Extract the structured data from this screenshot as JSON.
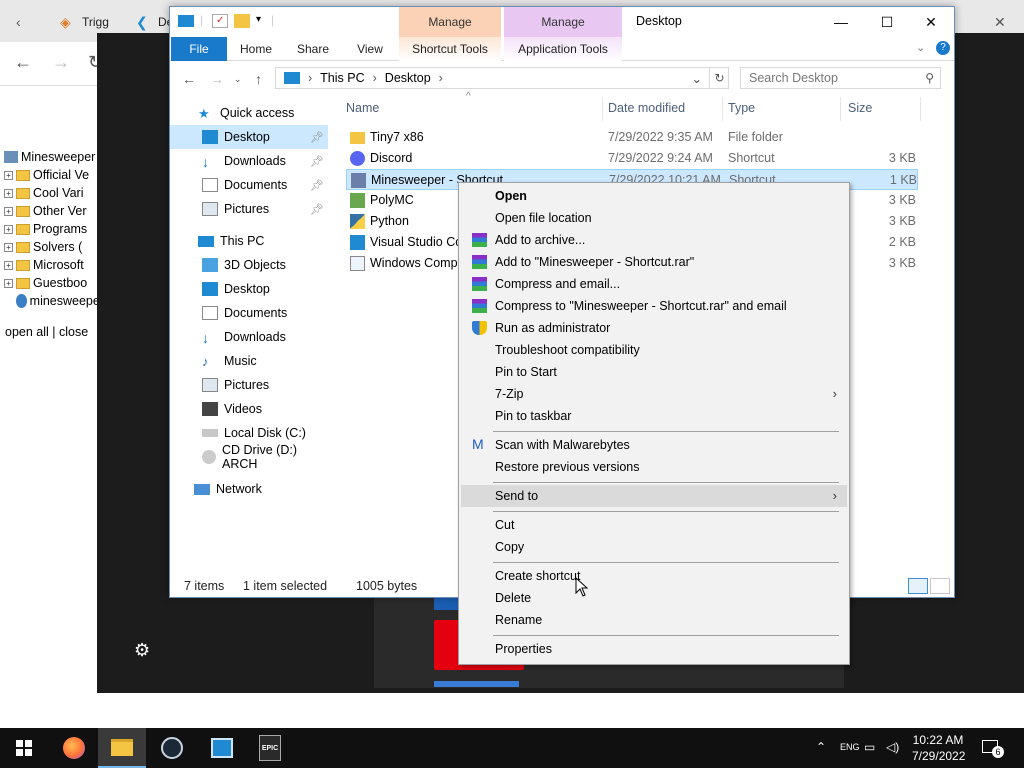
{
  "background_browser": {
    "tabs": [
      {
        "label": "Trigg"
      },
      {
        "label": "De"
      }
    ],
    "tree_items": [
      {
        "label": "Minesweeper"
      },
      {
        "label": "Official Ve"
      },
      {
        "label": "Cool Vari"
      },
      {
        "label": "Other Ver"
      },
      {
        "label": "Programs"
      },
      {
        "label": "Solvers ("
      },
      {
        "label": "Microsoft"
      },
      {
        "label": "Guestboo"
      },
      {
        "label": "minesweeper"
      }
    ],
    "open_all_text": "open all | close"
  },
  "explorer": {
    "title": "Desktop",
    "context_tabs": {
      "manage1": "Manage",
      "manage2": "Manage"
    },
    "ribbon_tabs": {
      "file": "File",
      "home": "Home",
      "share": "Share",
      "view": "View",
      "shortcut_tools": "Shortcut Tools",
      "application_tools": "Application Tools"
    },
    "address": {
      "root": "This PC",
      "current": "Desktop"
    },
    "search_placeholder": "Search Desktop",
    "nav": {
      "quick_access": "Quick access",
      "quick_items": [
        {
          "label": "Desktop",
          "pinned": true
        },
        {
          "label": "Downloads",
          "pinned": true
        },
        {
          "label": "Documents",
          "pinned": true
        },
        {
          "label": "Pictures",
          "pinned": true
        }
      ],
      "this_pc": "This PC",
      "pc_items": [
        {
          "label": "3D Objects"
        },
        {
          "label": "Desktop"
        },
        {
          "label": "Documents"
        },
        {
          "label": "Downloads"
        },
        {
          "label": "Music"
        },
        {
          "label": "Pictures"
        },
        {
          "label": "Videos"
        },
        {
          "label": "Local Disk (C:)"
        },
        {
          "label": "CD Drive (D:) ARCH"
        }
      ],
      "network": "Network"
    },
    "columns": {
      "name": "Name",
      "date": "Date modified",
      "type": "Type",
      "size": "Size"
    },
    "files": [
      {
        "name": "Tiny7 x86",
        "date": "7/29/2022 9:35 AM",
        "type": "File folder",
        "size": ""
      },
      {
        "name": "Discord",
        "date": "7/29/2022 9:24 AM",
        "type": "Shortcut",
        "size": "3 KB"
      },
      {
        "name": "Minesweeper - Shortcut",
        "date": "7/29/2022 10:21 AM",
        "type": "Shortcut",
        "size": "1 KB"
      },
      {
        "name": "PolyMC",
        "date": "",
        "type": "",
        "size": "3 KB"
      },
      {
        "name": "Python",
        "date": "",
        "type": "",
        "size": "3 KB"
      },
      {
        "name": "Visual Studio Coc",
        "date": "",
        "type": "",
        "size": "2 KB"
      },
      {
        "name": "Windows Compa",
        "date": "",
        "type": "",
        "size": "3 KB"
      }
    ],
    "status": {
      "items": "7 items",
      "selected": "1 item selected",
      "bytes": "1005 bytes"
    }
  },
  "context_menu": {
    "items": [
      {
        "label": "Open"
      },
      {
        "label": "Open file location"
      },
      {
        "label": "Add to archive..."
      },
      {
        "label": "Add to \"Minesweeper - Shortcut.rar\""
      },
      {
        "label": "Compress and email..."
      },
      {
        "label": "Compress to \"Minesweeper - Shortcut.rar\" and email"
      },
      {
        "label": "Run as administrator"
      },
      {
        "label": "Troubleshoot compatibility"
      },
      {
        "label": "Pin to Start"
      },
      {
        "label": "7-Zip"
      },
      {
        "label": "Pin to taskbar"
      },
      {
        "label": "Scan with Malwarebytes"
      },
      {
        "label": "Restore previous versions"
      },
      {
        "label": "Send to"
      },
      {
        "label": "Cut"
      },
      {
        "label": "Copy"
      },
      {
        "label": "Create shortcut"
      },
      {
        "label": "Delete"
      },
      {
        "label": "Rename"
      },
      {
        "label": "Properties"
      }
    ]
  },
  "taskbar": {
    "time": "10:22 AM",
    "date": "7/29/2022",
    "notification_count": "6"
  },
  "colors": {
    "accent": "#1979ca",
    "selection": "#cce8ff",
    "manage_orange": "#fcd2b6",
    "manage_purple": "#e8c8f2"
  }
}
